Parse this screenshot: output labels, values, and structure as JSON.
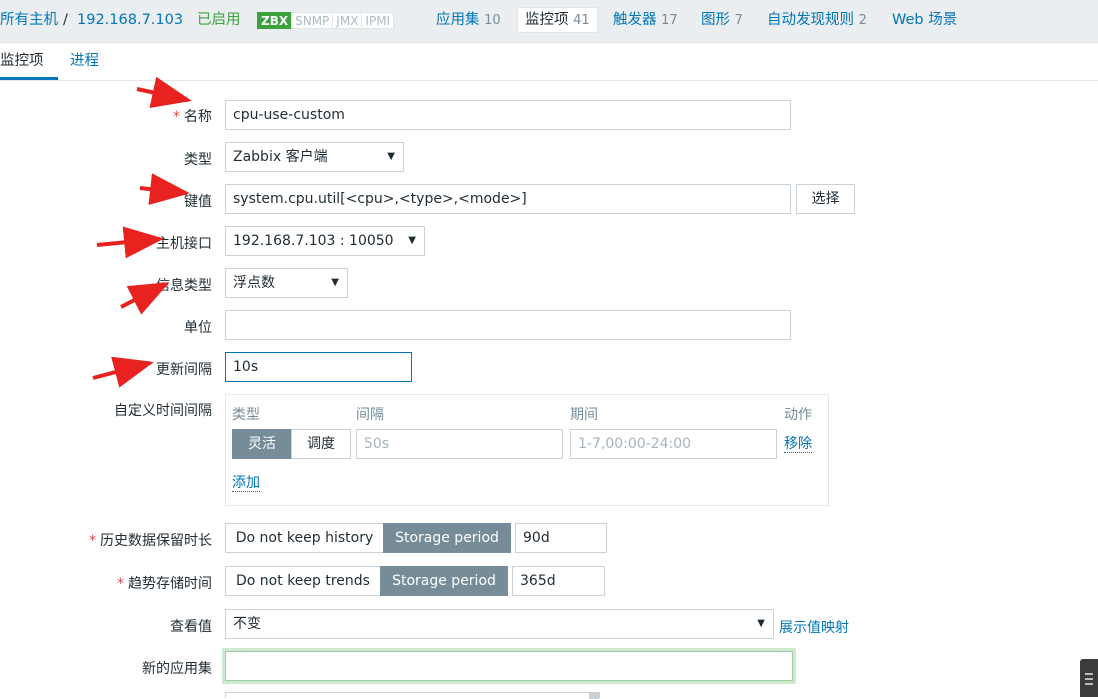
{
  "breadcrumb": {
    "all_hosts": "所有主机",
    "separator": "/",
    "host": "192.168.7.103",
    "status": "已启用"
  },
  "availability": [
    "ZBX",
    "SNMP",
    "JMX",
    "IPMI"
  ],
  "host_tabs": [
    {
      "label": "应用集",
      "count": "10"
    },
    {
      "label": "监控项",
      "count": "41"
    },
    {
      "label": "触发器",
      "count": "17"
    },
    {
      "label": "图形",
      "count": "7"
    },
    {
      "label": "自动发现规则",
      "count": "2"
    },
    {
      "label": "Web 场景",
      "count": ""
    }
  ],
  "sub_tabs": [
    "监控项",
    "进程"
  ],
  "form": {
    "name": {
      "label": "名称",
      "required": "*",
      "value": "cpu-use-custom"
    },
    "type": {
      "label": "类型",
      "value": "Zabbix 客户端"
    },
    "key": {
      "label": "键值",
      "value": "system.cpu.util[<cpu>,<type>,<mode>]",
      "button": "选择"
    },
    "interface": {
      "label": "主机接口",
      "value": "192.168.7.103 : 10050"
    },
    "info_type": {
      "label": "信息类型",
      "value": "浮点数"
    },
    "units": {
      "label": "单位",
      "value": ""
    },
    "update_interval": {
      "label": "更新间隔",
      "value": "10s"
    },
    "custom_intervals": {
      "label": "自定义时间间隔",
      "col_type": "类型",
      "col_interval": "间隔",
      "col_period": "期间",
      "col_action": "动作",
      "flexible": "灵活",
      "scheduling": "调度",
      "interval_placeholder": "50s",
      "period_placeholder": "1-7,00:00-24:00",
      "remove": "移除",
      "add": "添加"
    },
    "history": {
      "label": "历史数据保留时长",
      "required": "*",
      "no_keep": "Do not keep history",
      "storage": "Storage period",
      "value": "90d"
    },
    "trends": {
      "label": "趋势存储时间",
      "required": "*",
      "no_keep": "Do not keep trends",
      "storage": "Storage period",
      "value": "365d"
    },
    "show_value": {
      "label": "查看值",
      "value": "不变",
      "link": "展示值映射"
    },
    "new_app": {
      "label": "新的应用集",
      "value": ""
    }
  },
  "icons": {
    "dropdown": "chevron-down-icon",
    "annotation": "red-arrow-icon"
  },
  "colors": {
    "link": "#0275b8",
    "enabled": "#3da13d",
    "selected_btn": "#768d99",
    "required": "#d64e4e",
    "annotation": "#e8221e"
  }
}
